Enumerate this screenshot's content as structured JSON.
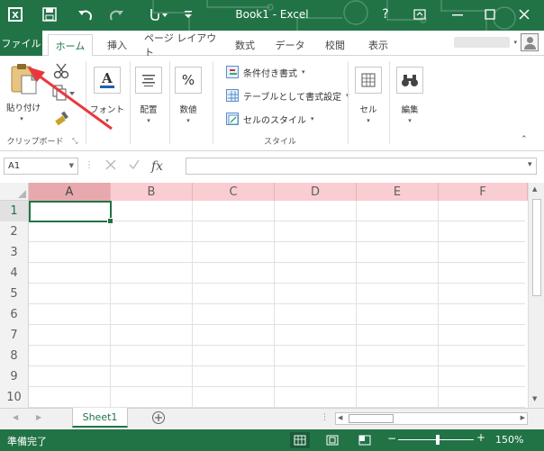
{
  "window": {
    "title": "Book1 - Excel",
    "help_label": "?"
  },
  "ribbon_tabs": [
    {
      "label": "ファイル"
    },
    {
      "label": "ホーム"
    },
    {
      "label": "挿入"
    },
    {
      "label": "ページ レイアウト"
    },
    {
      "label": "数式"
    },
    {
      "label": "データ"
    },
    {
      "label": "校閲"
    },
    {
      "label": "表示"
    }
  ],
  "ribbon": {
    "clipboard": {
      "paste_label": "貼り付け",
      "group_label": "クリップボード"
    },
    "font": {
      "label": "フォント"
    },
    "alignment": {
      "label": "配置"
    },
    "number": {
      "label": "数値",
      "icon_glyph": "%"
    },
    "styles": {
      "conditional_format": "条件付き書式",
      "format_as_table": "テーブルとして書式設定",
      "cell_styles": "セルのスタイル",
      "group_label": "スタイル"
    },
    "cells": {
      "label": "セル"
    },
    "editing": {
      "label": "編集"
    }
  },
  "formula_bar": {
    "name_box": "A1",
    "fx_label": "fx",
    "value": ""
  },
  "grid": {
    "columns": [
      "A",
      "B",
      "C",
      "D",
      "E",
      "F"
    ],
    "rows": [
      "1",
      "2",
      "3",
      "4",
      "5",
      "6",
      "7",
      "8",
      "9",
      "10"
    ],
    "selected_cell": "A1"
  },
  "sheets": [
    {
      "name": "Sheet1",
      "active": true
    }
  ],
  "status": {
    "ready_text": "準備完了",
    "zoom_label": "150%"
  },
  "colors": {
    "accent": "#217346",
    "column_header_highlight": "#f9cdd2",
    "annotation_arrow": "#e8383d"
  }
}
